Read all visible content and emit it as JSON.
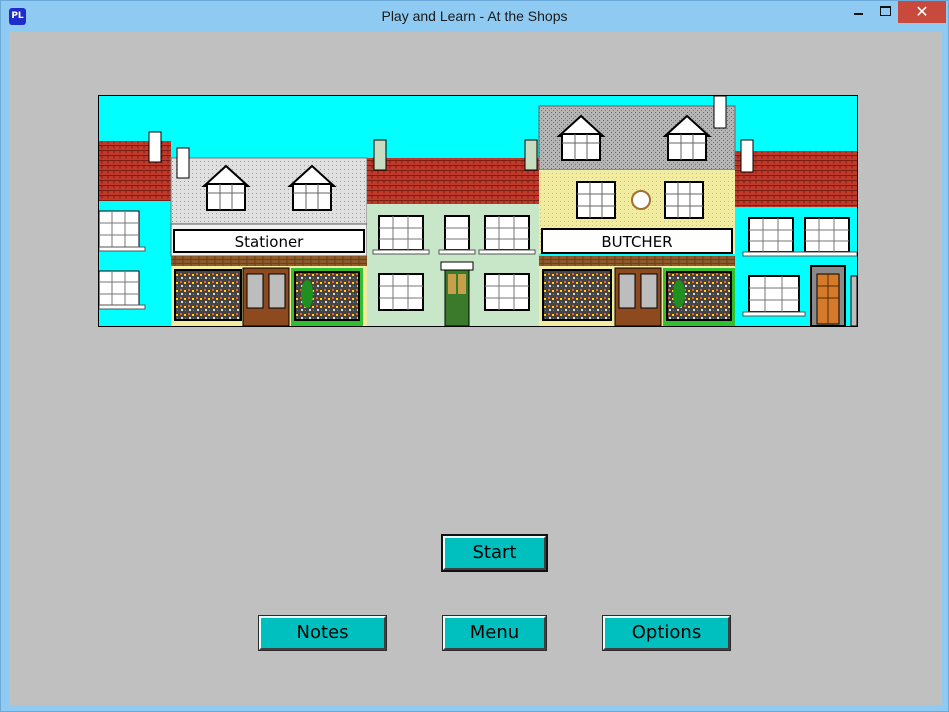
{
  "window": {
    "icon_text": "PL",
    "title": "Play and Learn - At the Shops",
    "controls": {
      "minimize": "minimize",
      "maximize": "maximize",
      "close": "✕"
    }
  },
  "scene": {
    "shop_signs": {
      "stationer": "Stationer",
      "butcher": "BUTCHER"
    }
  },
  "buttons": {
    "start": "Start",
    "notes": "Notes",
    "menu": "Menu",
    "options": "Options"
  },
  "colors": {
    "sky": "#00ffff",
    "client_bg": "#c0c0c0",
    "button_teal": "#00bfbf",
    "roof_red": "#c0392b",
    "titlebar": "#8fcaf2"
  }
}
